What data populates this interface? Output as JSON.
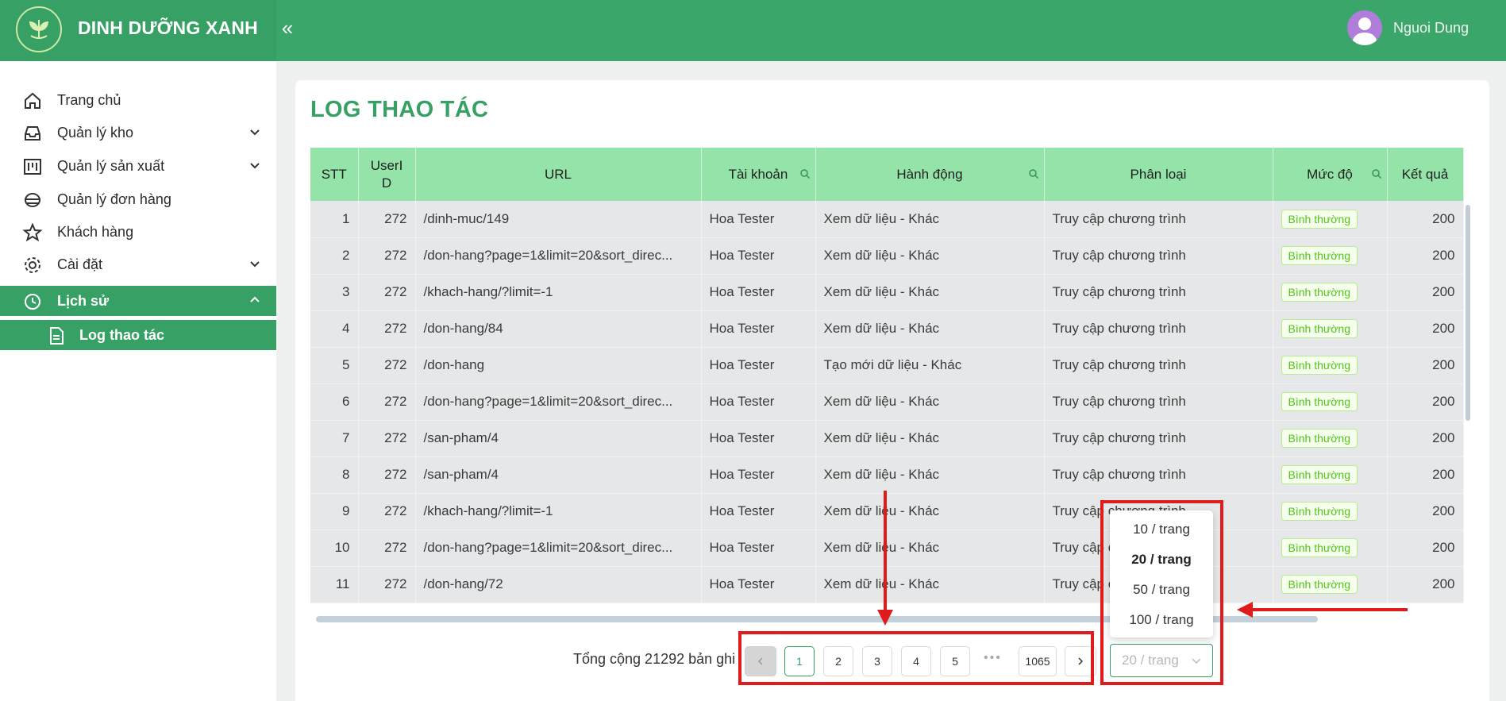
{
  "app": {
    "title": "DINH DƯỠNG XANH",
    "user_name": "Nguoi Dung"
  },
  "sidebar": {
    "items": [
      {
        "label": "Trang chủ",
        "icon": "home-icon"
      },
      {
        "label": "Quản lý kho",
        "icon": "inbox-icon",
        "expandable": true
      },
      {
        "label": "Quản lý sản xuất",
        "icon": "factory-icon",
        "expandable": true
      },
      {
        "label": "Quản lý đơn hàng",
        "icon": "order-icon"
      },
      {
        "label": "Khách hàng",
        "icon": "star-icon"
      },
      {
        "label": "Cài đặt",
        "icon": "gear-icon",
        "expandable": true
      },
      {
        "label": "Lịch sử",
        "icon": "history-icon",
        "expanded": true,
        "active": true
      },
      {
        "label": "Log thao tác",
        "icon": "document-icon",
        "selected": true
      }
    ]
  },
  "page": {
    "title": "LOG THAO TÁC"
  },
  "table": {
    "columns": [
      "STT",
      "UserID",
      "URL",
      "Tài khoản",
      "Hành động",
      "Phân loại",
      "Mức độ",
      "Kết quả"
    ],
    "rows": [
      [
        "1",
        "272",
        "/dinh-muc/149",
        "Hoa Tester",
        "Xem dữ liệu - Khác",
        "Truy cập chương trình",
        "Bình thường",
        "200"
      ],
      [
        "2",
        "272",
        "/don-hang?page=1&limit=20&sort_direc...",
        "Hoa Tester",
        "Xem dữ liệu - Khác",
        "Truy cập chương trình",
        "Bình thường",
        "200"
      ],
      [
        "3",
        "272",
        "/khach-hang/?limit=-1",
        "Hoa Tester",
        "Xem dữ liệu - Khác",
        "Truy cập chương trình",
        "Bình thường",
        "200"
      ],
      [
        "4",
        "272",
        "/don-hang/84",
        "Hoa Tester",
        "Xem dữ liệu - Khác",
        "Truy cập chương trình",
        "Bình thường",
        "200"
      ],
      [
        "5",
        "272",
        "/don-hang",
        "Hoa Tester",
        "Tạo mới dữ liệu - Khác",
        "Truy cập chương trình",
        "Bình thường",
        "200"
      ],
      [
        "6",
        "272",
        "/don-hang?page=1&limit=20&sort_direc...",
        "Hoa Tester",
        "Xem dữ liệu - Khác",
        "Truy cập chương trình",
        "Bình thường",
        "200"
      ],
      [
        "7",
        "272",
        "/san-pham/4",
        "Hoa Tester",
        "Xem dữ liệu - Khác",
        "Truy cập chương trình",
        "Bình thường",
        "200"
      ],
      [
        "8",
        "272",
        "/san-pham/4",
        "Hoa Tester",
        "Xem dữ liệu - Khác",
        "Truy cập chương trình",
        "Bình thường",
        "200"
      ],
      [
        "9",
        "272",
        "/khach-hang/?limit=-1",
        "Hoa Tester",
        "Xem dữ liệu - Khác",
        "Truy cập chương trình",
        "Bình thường",
        "200"
      ],
      [
        "10",
        "272",
        "/don-hang?page=1&limit=20&sort_direc...",
        "Hoa Tester",
        "Xem dữ liệu - Khác",
        "Truy cập chương trình",
        "Bình thường",
        "200"
      ],
      [
        "11",
        "272",
        "/don-hang/72",
        "Hoa Tester",
        "Xem dữ liệu - Khác",
        "Truy cập chương trình",
        "Bình thường",
        "200"
      ]
    ]
  },
  "pagination": {
    "total_text": "Tổng cộng 21292 bản ghi",
    "pages": [
      "1",
      "2",
      "3",
      "4",
      "5"
    ],
    "last_page": "1065",
    "dots": "•••",
    "current": "1",
    "page_size_placeholder": "20 / trang",
    "page_size_options": [
      "10 / trang",
      "20 / trang",
      "50 / trang",
      "100 / trang"
    ],
    "selected_option": "20 / trang"
  },
  "colors": {
    "brand": "#37a065",
    "header": "#3aa66a",
    "table_header": "#94e3a8",
    "annotation": "#e01b1b"
  }
}
